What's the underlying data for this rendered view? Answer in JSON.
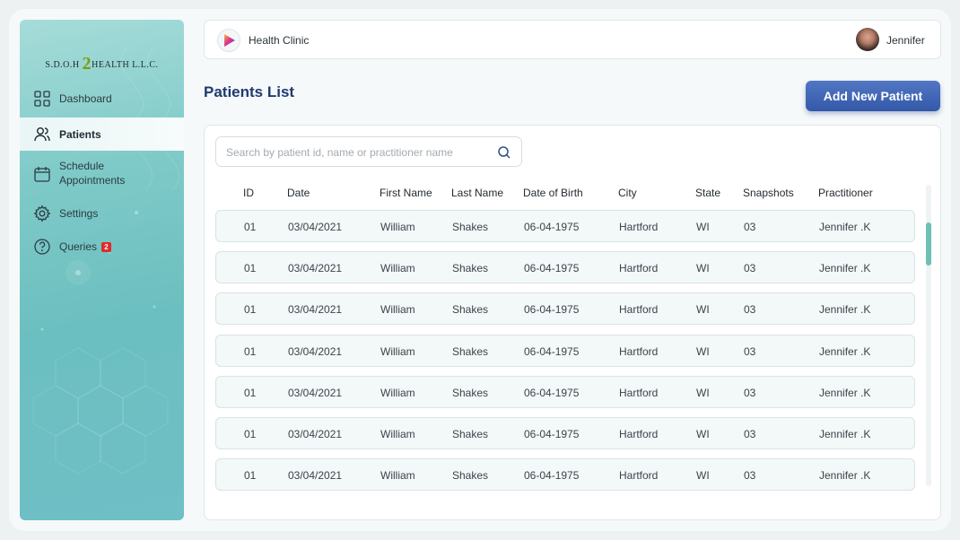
{
  "sidebar": {
    "logo": {
      "left": "S.D.O.H",
      "digit": "2",
      "right": "HEALTH L.L.C."
    },
    "items": [
      {
        "label": "Dashboard",
        "icon": "grid-icon"
      },
      {
        "label": "Patients",
        "icon": "users-icon",
        "active": true
      },
      {
        "label": "Schedule Appointments",
        "line1": "Schedule",
        "line2": "Appointments",
        "icon": "calendar-icon"
      },
      {
        "label": "Settings",
        "icon": "gear-icon"
      },
      {
        "label": "Queries",
        "icon": "help-icon",
        "badge": "2"
      }
    ]
  },
  "header": {
    "clinic_name": "Health Clinic",
    "user_name": "Jennifer"
  },
  "main": {
    "title": "Patients List",
    "add_button": "Add New Patient",
    "search_placeholder": "Search by patient id, name or practitioner name"
  },
  "table": {
    "columns": [
      "ID",
      "Date",
      "First Name",
      "Last Name",
      "Date of Birth",
      "City",
      "State",
      "Snapshots",
      "Practitioner"
    ],
    "rows": [
      [
        "01",
        "03/04/2021",
        "William",
        "Shakes",
        "06-04-1975",
        "Hartford",
        "WI",
        "03",
        "Jennifer .K"
      ],
      [
        "01",
        "03/04/2021",
        "William",
        "Shakes",
        "06-04-1975",
        "Hartford",
        "WI",
        "03",
        "Jennifer .K"
      ],
      [
        "01",
        "03/04/2021",
        "William",
        "Shakes",
        "06-04-1975",
        "Hartford",
        "WI",
        "03",
        "Jennifer .K"
      ],
      [
        "01",
        "03/04/2021",
        "William",
        "Shakes",
        "06-04-1975",
        "Hartford",
        "WI",
        "03",
        "Jennifer .K"
      ],
      [
        "01",
        "03/04/2021",
        "William",
        "Shakes",
        "06-04-1975",
        "Hartford",
        "WI",
        "03",
        "Jennifer .K"
      ],
      [
        "01",
        "03/04/2021",
        "William",
        "Shakes",
        "06-04-1975",
        "Hartford",
        "WI",
        "03",
        "Jennifer .K"
      ],
      [
        "01",
        "03/04/2021",
        "William",
        "Shakes",
        "06-04-1975",
        "Hartford",
        "WI",
        "03",
        "Jennifer .K"
      ]
    ]
  },
  "colors": {
    "accent": "#3a5fb0",
    "title": "#1f3a6e",
    "sidebar": "#7fcac8",
    "badge": "#e02a2a",
    "scrollbar": "#6fbfb6"
  }
}
